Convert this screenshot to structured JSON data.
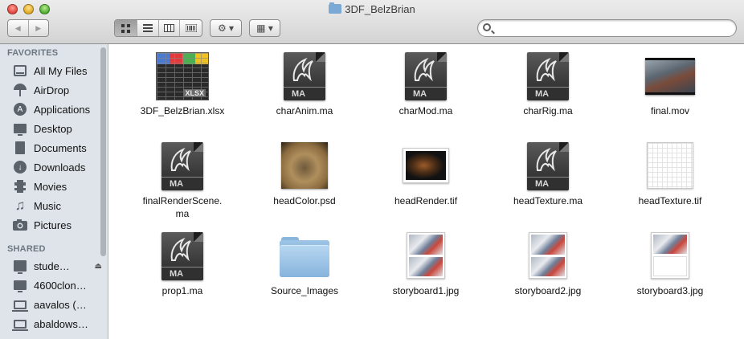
{
  "window": {
    "title": "3DF_BelzBrian"
  },
  "toolbar": {
    "back_glyph": "◀",
    "forward_glyph": "▶",
    "view_buttons": [
      "icon-view",
      "list-view",
      "column-view",
      "cover-flow-view"
    ],
    "action_glyph": "⚙ ▾",
    "arrange_glyph": "▦ ▾"
  },
  "search": {
    "value": "",
    "placeholder": ""
  },
  "sidebar": {
    "favorites_heading": "FAVORITES",
    "favorites": [
      {
        "label": "All My Files",
        "icon": "all-files-icon"
      },
      {
        "label": "AirDrop",
        "icon": "airdrop-icon"
      },
      {
        "label": "Applications",
        "icon": "applications-icon"
      },
      {
        "label": "Desktop",
        "icon": "desktop-icon"
      },
      {
        "label": "Documents",
        "icon": "documents-icon"
      },
      {
        "label": "Downloads",
        "icon": "downloads-icon"
      },
      {
        "label": "Movies",
        "icon": "movies-icon"
      },
      {
        "label": "Music",
        "icon": "music-icon"
      },
      {
        "label": "Pictures",
        "icon": "pictures-icon"
      }
    ],
    "shared_heading": "SHARED",
    "shared": [
      {
        "label": "stude…",
        "icon": "server-icon"
      },
      {
        "label": "4600clon…",
        "icon": "computer-icon"
      },
      {
        "label": "aavalos (…",
        "icon": "laptop-icon"
      },
      {
        "label": "abaldows…",
        "icon": "laptop-icon"
      }
    ]
  },
  "files": [
    {
      "name": "3DF_BelzBrian.xlsx",
      "kind": "xlsx",
      "badge": "XLSX"
    },
    {
      "name": "charAnim.ma",
      "kind": "maya",
      "badge": "MA"
    },
    {
      "name": "charMod.ma",
      "kind": "maya",
      "badge": "MA"
    },
    {
      "name": "charRig.ma",
      "kind": "maya",
      "badge": "MA"
    },
    {
      "name": "final.mov",
      "kind": "movie"
    },
    {
      "name": "finalRenderScene.\nma",
      "kind": "maya",
      "badge": "MA"
    },
    {
      "name": "headColor.psd",
      "kind": "psd"
    },
    {
      "name": "headRender.tif",
      "kind": "tif-render"
    },
    {
      "name": "headTexture.ma",
      "kind": "maya",
      "badge": "MA"
    },
    {
      "name": "headTexture.tif",
      "kind": "tif-texture"
    },
    {
      "name": "prop1.ma",
      "kind": "maya",
      "badge": "MA"
    },
    {
      "name": "Source_Images",
      "kind": "folder"
    },
    {
      "name": "storyboard1.jpg",
      "kind": "storyboard"
    },
    {
      "name": "storyboard2.jpg",
      "kind": "storyboard"
    },
    {
      "name": "storyboard3.jpg",
      "kind": "storyboard-partial"
    }
  ]
}
